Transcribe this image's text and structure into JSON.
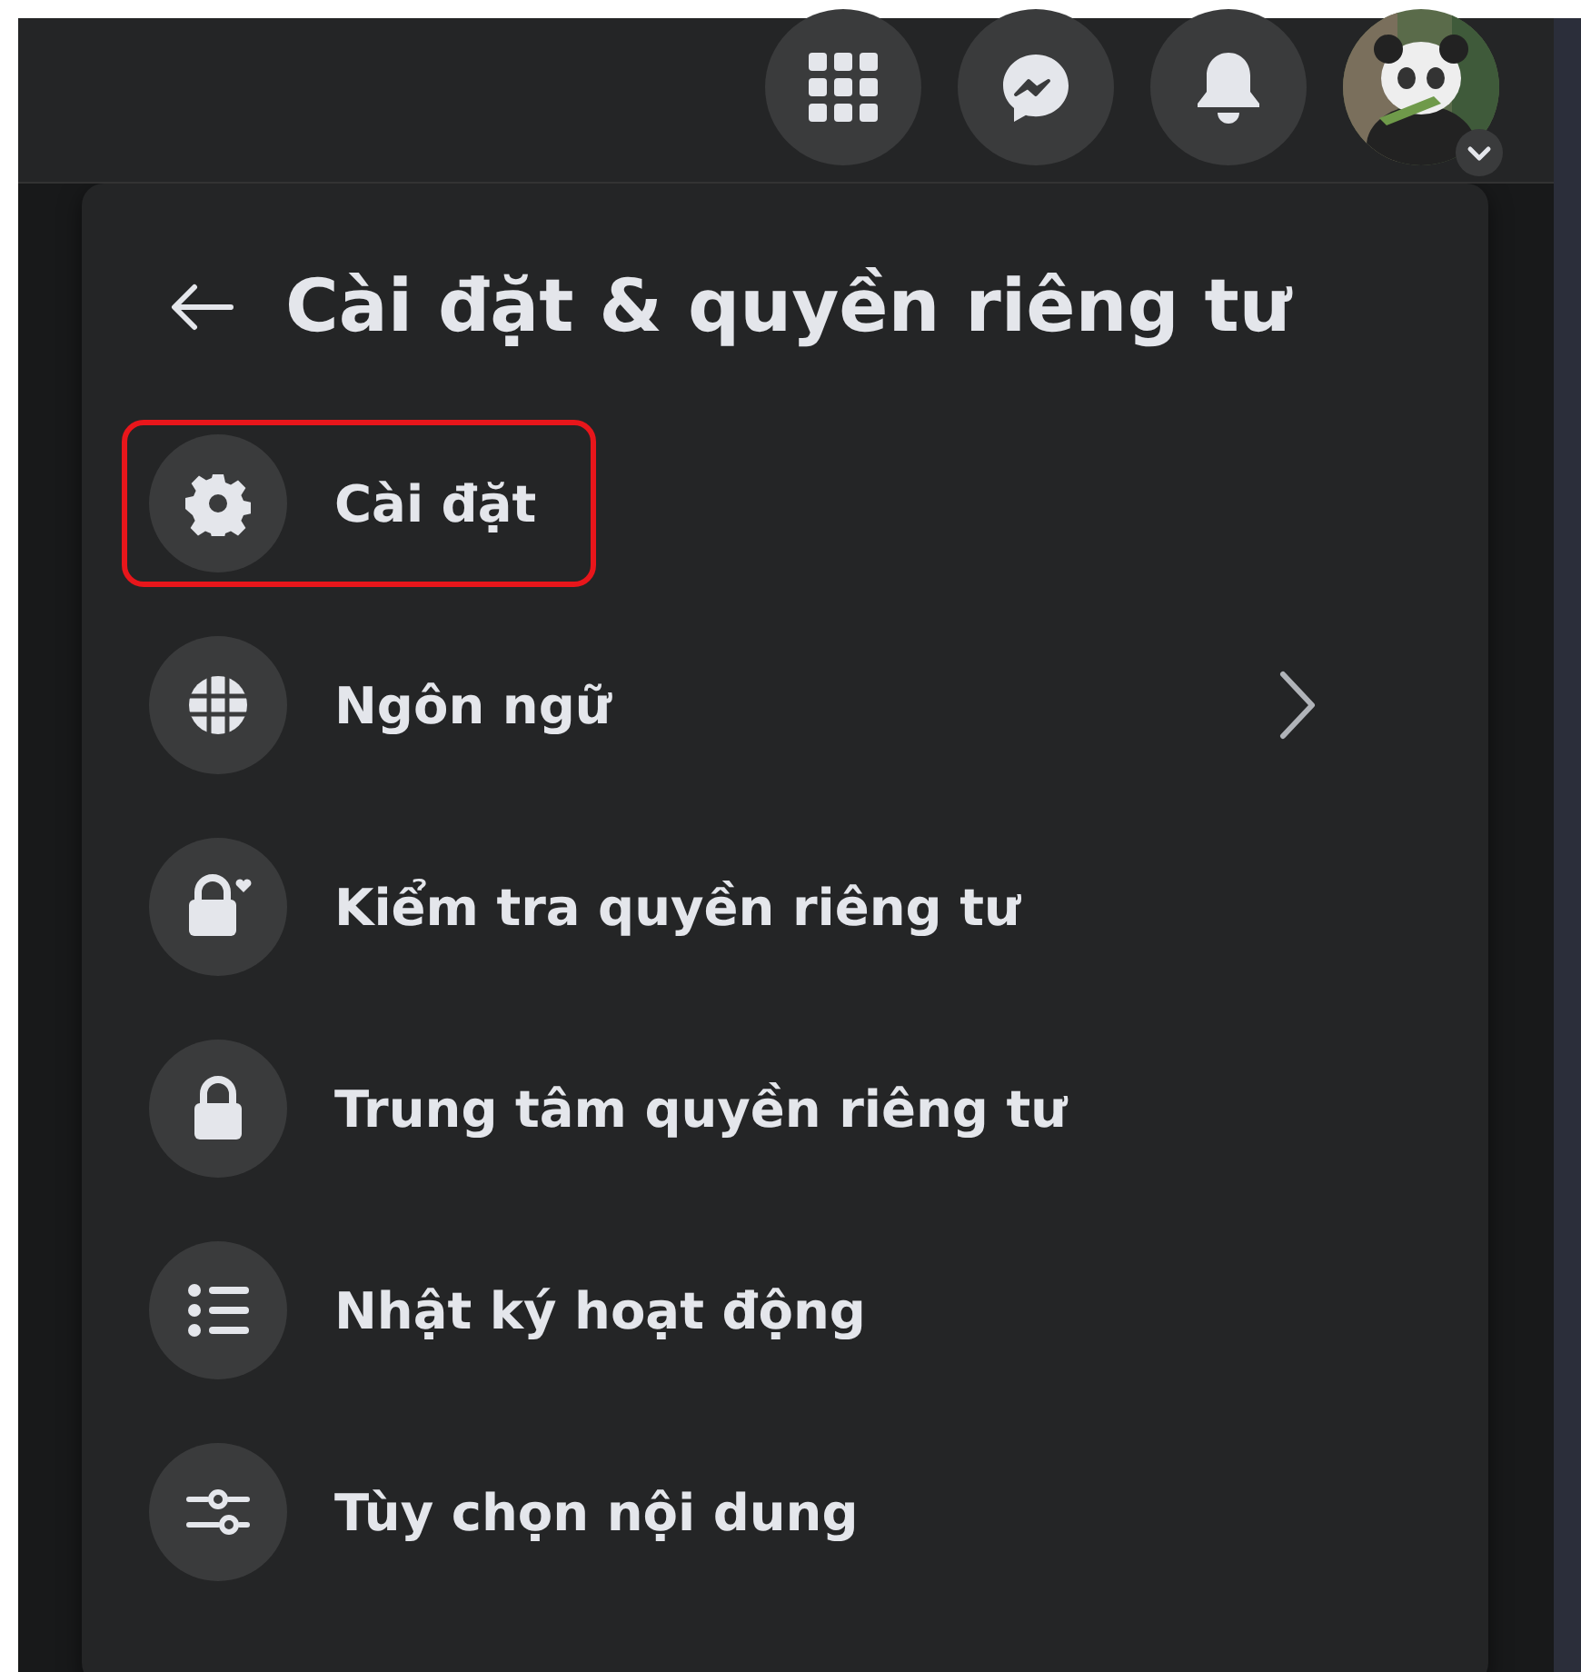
{
  "top_bar": {
    "buttons": [
      {
        "kind": "grid"
      },
      {
        "kind": "messenger"
      },
      {
        "kind": "bell"
      }
    ]
  },
  "menu": {
    "title": "Cài đặt & quyền riêng tư",
    "items": [
      {
        "kind": "gear",
        "label": "Cài đặt",
        "highlighted": true,
        "submenu": false
      },
      {
        "kind": "globe",
        "label": "Ngôn ngữ",
        "highlighted": false,
        "submenu": true
      },
      {
        "kind": "lock-heart",
        "label": "Kiểm tra quyền riêng tư",
        "highlighted": false,
        "submenu": false
      },
      {
        "kind": "lock",
        "label": "Trung tâm quyền riêng tư",
        "highlighted": false,
        "submenu": false
      },
      {
        "kind": "list",
        "label": "Nhật ký hoạt động",
        "highlighted": false,
        "submenu": false
      },
      {
        "kind": "sliders",
        "label": "Tùy chọn nội dung",
        "highlighted": false,
        "submenu": false
      }
    ]
  }
}
